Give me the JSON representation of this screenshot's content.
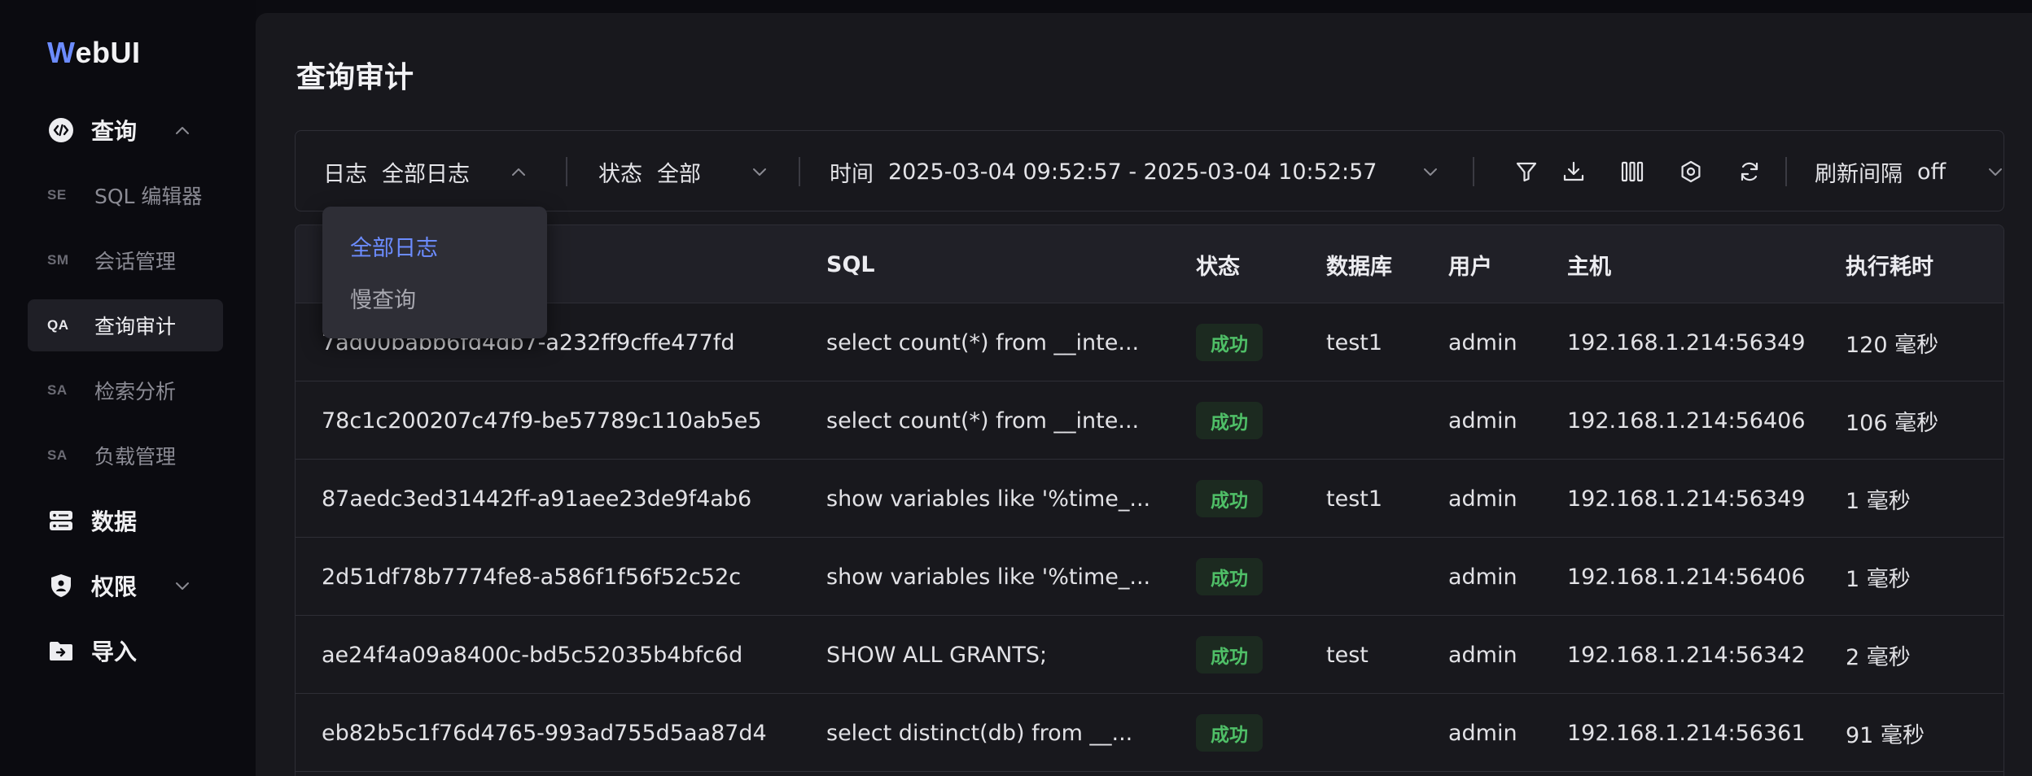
{
  "app": {
    "logo_initial": "W",
    "logo_rest": "ebUI"
  },
  "sidebar": {
    "groups": [
      {
        "label": "查询",
        "icon": "code-icon",
        "expanded": true
      },
      {
        "label": "数据",
        "icon": "server-icon"
      },
      {
        "label": "权限",
        "icon": "shield-icon",
        "expanded": false
      },
      {
        "label": "导入",
        "icon": "folder-import-icon"
      }
    ],
    "items": [
      {
        "abbr": "SE",
        "label": "SQL 编辑器"
      },
      {
        "abbr": "SM",
        "label": "会话管理"
      },
      {
        "abbr": "QA",
        "label": "查询审计",
        "active": true
      },
      {
        "abbr": "SA",
        "label": "检索分析"
      },
      {
        "abbr": "SA",
        "label": "负载管理"
      }
    ]
  },
  "page": {
    "title": "查询审计"
  },
  "toolbar": {
    "log_label": "日志",
    "log_value": "全部日志",
    "status_label": "状态",
    "status_value": "全部",
    "time_label": "时间",
    "time_value": "2025-03-04 09:52:57 - 2025-03-04 10:52:57",
    "refresh_label": "刷新间隔",
    "refresh_value": "off",
    "icons": [
      "filter-icon",
      "download-icon",
      "columns-icon",
      "settings-icon",
      "refresh-icon"
    ]
  },
  "dropdown": {
    "options": [
      "全部日志",
      "慢查询"
    ],
    "selected": "全部日志"
  },
  "table": {
    "columns": [
      "SQL",
      "状态",
      "数据库",
      "用户",
      "主机",
      "执行耗时"
    ],
    "rows": [
      {
        "id": "7ad00babb6fd4db7-a232ff9cffe477fd",
        "sql": "select count(*) from __inte...",
        "status": "成功",
        "db": "test1",
        "user": "admin",
        "host": "192.168.1.214:56349",
        "duration": "120 毫秒"
      },
      {
        "id": "78c1c200207c47f9-be57789c110ab5e5",
        "sql": "select count(*) from __inte...",
        "status": "成功",
        "db": "",
        "user": "admin",
        "host": "192.168.1.214:56406",
        "duration": "106 毫秒"
      },
      {
        "id": "87aedc3ed31442ff-a91aee23de9f4ab6",
        "sql": "show variables like '%time_...",
        "status": "成功",
        "db": "test1",
        "user": "admin",
        "host": "192.168.1.214:56349",
        "duration": "1 毫秒"
      },
      {
        "id": "2d51df78b7774fe8-a586f1f56f52c52c",
        "sql": "show variables like '%time_...",
        "status": "成功",
        "db": "",
        "user": "admin",
        "host": "192.168.1.214:56406",
        "duration": "1 毫秒"
      },
      {
        "id": "ae24f4a09a8400c-bd5c52035b4bfc6d",
        "sql": "SHOW ALL GRANTS;",
        "status": "成功",
        "db": "test",
        "user": "admin",
        "host": "192.168.1.214:56342",
        "duration": "2 毫秒"
      },
      {
        "id": "eb82b5c1f76d4765-993ad755d5aa87d4",
        "sql": "select distinct(db) from __...",
        "status": "成功",
        "db": "",
        "user": "admin",
        "host": "192.168.1.214:56361",
        "duration": "91 毫秒"
      }
    ]
  },
  "colors": {
    "accent": "#6c8cff",
    "success": "#4fbf67",
    "background": "#18181d"
  }
}
